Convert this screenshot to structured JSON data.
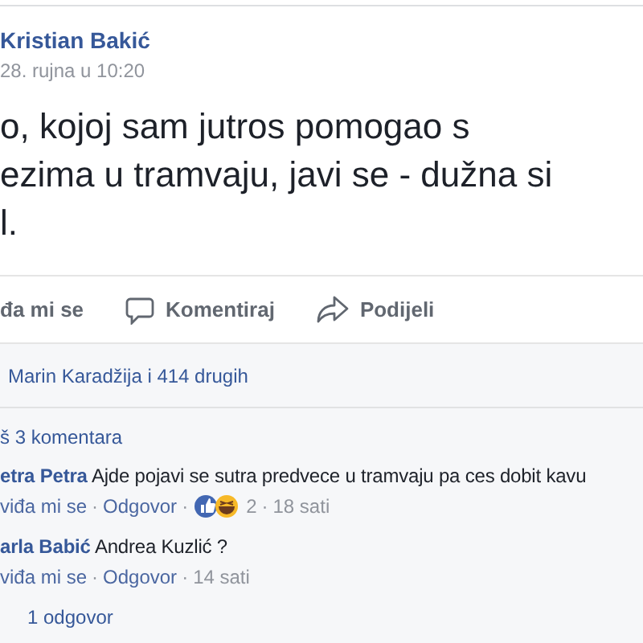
{
  "post": {
    "author": "Kristian Bakić",
    "time": "28. rujna u 10:20",
    "text_lines": [
      "o, kojoj sam jutros pomogao s",
      "ezima u tramvaju, javi se - dužna si",
      "l."
    ]
  },
  "actions": [
    {
      "kind": "like",
      "label": "đa mi se"
    },
    {
      "kind": "comment",
      "label": "Komentiraj"
    },
    {
      "kind": "share",
      "label": "Podijeli"
    }
  ],
  "likes_summary": "Marin Karadžija i 414 drugih",
  "more_comments": "š 3 komentara",
  "comments": [
    {
      "author": "etra Petra",
      "text": "Ajde pojavi se sutra predvece u tramvaju pa ces dobit kavu",
      "like_label": "viđa mi se",
      "separators": [
        "·",
        "·",
        "·"
      ],
      "reply_label": "Odgovor",
      "reaction_count": "2",
      "time": "18 sati"
    },
    {
      "author": "arla Babić",
      "text": "Andrea Kuzlić ?",
      "like_label": "viđa mi se",
      "separators": [
        "·",
        "·"
      ],
      "reply_label": "Odgovor",
      "time": "14 sati"
    }
  ],
  "replies_link": "1 odgovor"
}
